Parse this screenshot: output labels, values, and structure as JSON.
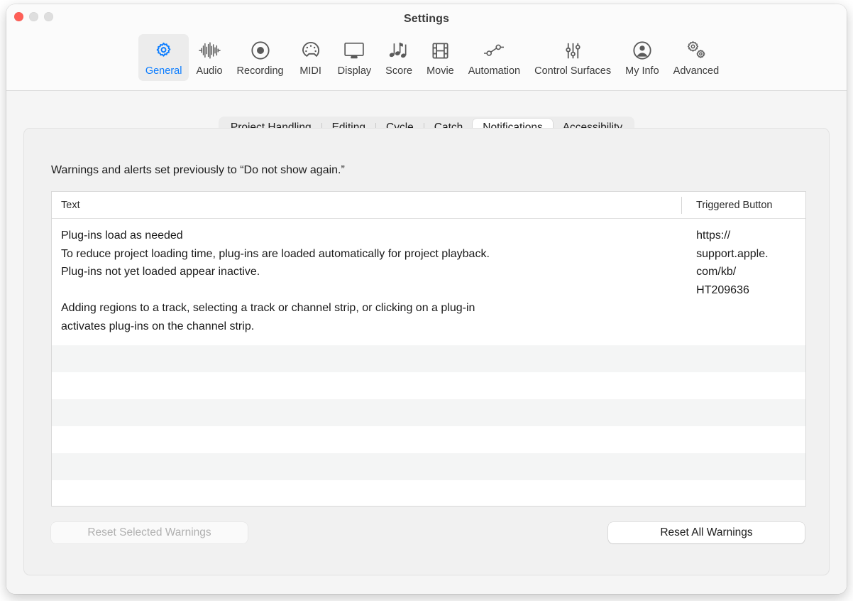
{
  "window": {
    "title": "Settings",
    "traffic_lights": [
      "close-button",
      "minimize-button",
      "maximize-button"
    ]
  },
  "toolbar": {
    "items": [
      {
        "label": "General",
        "icon": "gear-icon",
        "selected": true
      },
      {
        "label": "Audio",
        "icon": "waveform-icon",
        "selected": false
      },
      {
        "label": "Recording",
        "icon": "record-circle-icon",
        "selected": false
      },
      {
        "label": "MIDI",
        "icon": "midi-connector-icon",
        "selected": false
      },
      {
        "label": "Display",
        "icon": "monitor-icon",
        "selected": false
      },
      {
        "label": "Score",
        "icon": "music-notes-icon",
        "selected": false
      },
      {
        "label": "Movie",
        "icon": "film-strip-icon",
        "selected": false
      },
      {
        "label": "Automation",
        "icon": "node-graph-icon",
        "selected": false
      },
      {
        "label": "Control Surfaces",
        "icon": "sliders-icon",
        "selected": false
      },
      {
        "label": "My Info",
        "icon": "person-circle-icon",
        "selected": false
      },
      {
        "label": "Advanced",
        "icon": "double-gear-icon",
        "selected": false
      }
    ],
    "selected_accent": "#0a7cff"
  },
  "tabs": [
    {
      "label": "Project Handling",
      "selected": false
    },
    {
      "label": "Editing",
      "selected": false
    },
    {
      "label": "Cycle",
      "selected": false
    },
    {
      "label": "Catch",
      "selected": false
    },
    {
      "label": "Notifications",
      "selected": true
    },
    {
      "label": "Accessibility",
      "selected": false
    }
  ],
  "panel": {
    "caption": "Warnings and alerts set previously to “Do not show again.”",
    "table": {
      "columns": [
        "Text",
        "Triggered Button"
      ],
      "rows": [
        {
          "text": "Plug-ins load as needed\nTo reduce project loading time, plug-ins are loaded automatically for project playback.\nPlug-ins not yet loaded appear inactive.\n\nAdding regions to a track, selecting a track or channel strip, or clicking on a plug-in\nactivates plug-ins on the channel strip.",
          "triggered_button": "https://\nsupport.apple.\ncom/kb/\nHT209636"
        }
      ],
      "empty_row_count": 6
    },
    "buttons": {
      "reset_selected": {
        "label": "Reset Selected Warnings",
        "enabled": false
      },
      "reset_all": {
        "label": "Reset All Warnings",
        "enabled": true
      }
    }
  }
}
